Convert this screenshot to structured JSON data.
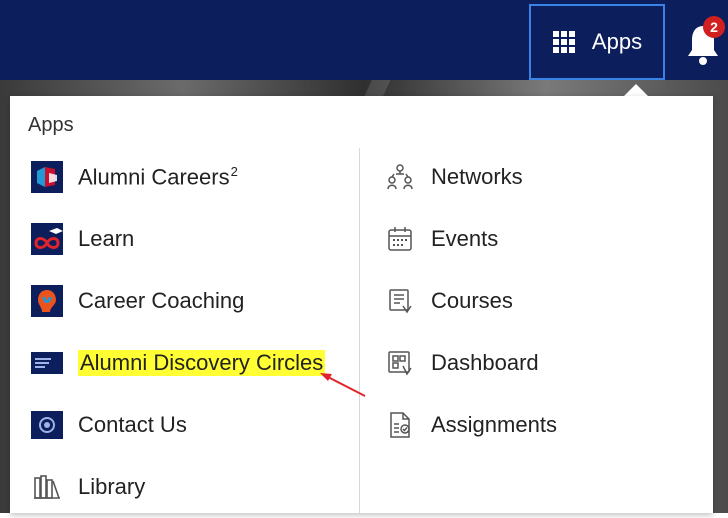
{
  "header": {
    "apps_label": "Apps",
    "notification_count": "2"
  },
  "menu": {
    "title": "Apps",
    "left": [
      {
        "label": "Alumni Careers",
        "superscript": "2",
        "icon": "alumni-careers-logo"
      },
      {
        "label": "Learn",
        "icon": "learn-logo"
      },
      {
        "label": "Career Coaching",
        "icon": "career-coaching-logo"
      },
      {
        "label": "Alumni Discovery Circles",
        "icon": "discovery-circles-logo",
        "highlighted": true
      },
      {
        "label": "Contact Us",
        "icon": "contact-us-logo"
      },
      {
        "label": "Library",
        "icon": "library-icon"
      }
    ],
    "right": [
      {
        "label": "Networks",
        "icon": "networks-icon"
      },
      {
        "label": "Events",
        "icon": "calendar-icon"
      },
      {
        "label": "Courses",
        "icon": "courses-icon"
      },
      {
        "label": "Dashboard",
        "icon": "dashboard-icon"
      },
      {
        "label": "Assignments",
        "icon": "assignments-icon"
      }
    ]
  },
  "colors": {
    "header_bg": "#0c1e5b",
    "highlight": "#ffff33",
    "annotation_arrow": "#e0242b",
    "badge": "#d21f1f"
  }
}
